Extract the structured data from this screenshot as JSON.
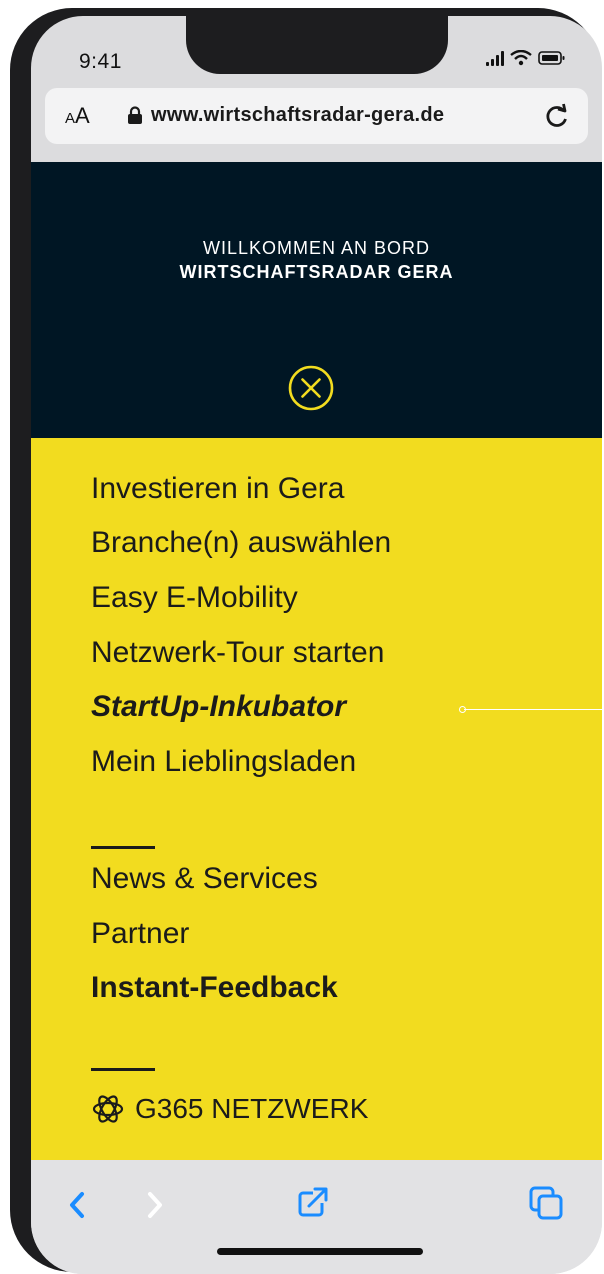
{
  "status": {
    "time": "9:41"
  },
  "browser": {
    "font_size_label_small": "A",
    "font_size_label_large": "A",
    "url": "www.wirtschaftsradar-gera.de"
  },
  "hero": {
    "line1": "WILLKOMMEN AN BORD",
    "line2": "WIRTSCHAFTSRADAR GERA"
  },
  "menu": {
    "primary": [
      "Investieren in Gera",
      "Branche(n) auswählen",
      "Easy E-Mobility",
      "Netzwerk-Tour starten",
      "StartUp-Inkubator",
      "Mein Lieblingsladen"
    ],
    "secondary": [
      "News & Services",
      "Partner",
      "Instant-Feedback"
    ],
    "network_label": "G365 NETZWERK"
  },
  "colors": {
    "hero_bg": "#001624",
    "menu_bg": "#f2dc1f",
    "accent_yellow": "#f2dc1f",
    "ios_blue": "#1a8cff"
  },
  "icons": [
    "lock-icon",
    "reload-icon",
    "close-circle-icon",
    "atom-icon",
    "back-chevron-icon",
    "forward-chevron-icon",
    "share-icon",
    "tabs-icon"
  ]
}
